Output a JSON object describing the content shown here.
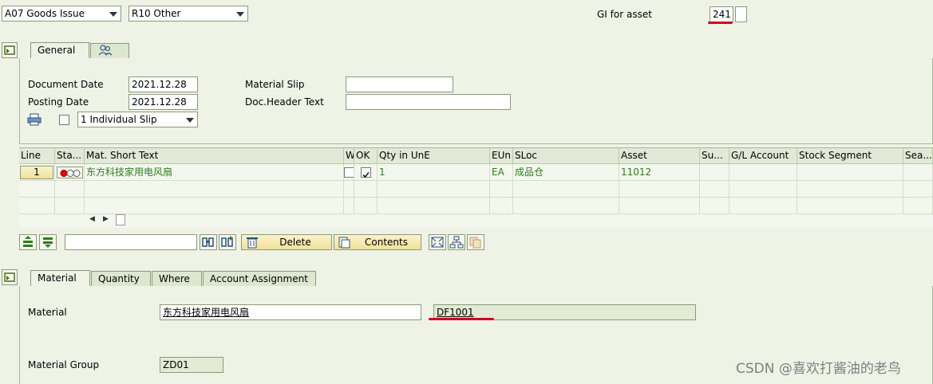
{
  "header": {
    "movement_type": "A07 Goods Issue",
    "reference": "R10 Other",
    "gi_for_asset_label": "GI for asset",
    "gi_for_asset_value": "241"
  },
  "header_tabs": [
    {
      "label": "General",
      "active": true
    },
    {
      "label": "",
      "icon": "persons-icon",
      "active": false
    }
  ],
  "general": {
    "document_date_label": "Document Date",
    "document_date": "2021.12.28",
    "posting_date_label": "Posting Date",
    "posting_date": "2021.12.28",
    "material_slip_label": "Material Slip",
    "material_slip": "",
    "doc_header_text_label": "Doc.Header Text",
    "doc_header_text": "",
    "slip_option": "1 Individual Slip"
  },
  "grid": {
    "columns": [
      "Line",
      "Sta...",
      "Mat. Short Text",
      "W",
      "OK",
      "Qty in UnE",
      "EUn",
      "SLoc",
      "Asset",
      "Su...",
      "G/L Account",
      "Stock Segment",
      "Sea..."
    ],
    "rows": [
      {
        "line": "1",
        "mat_short_text": "东方科技家用电风扇",
        "qty": "1",
        "eun": "EA",
        "sloc": "成品仓",
        "asset": "11012"
      }
    ]
  },
  "toolbar": {
    "delete_label": "Delete",
    "contents_label": "Contents"
  },
  "item_tabs": [
    {
      "label": "Material",
      "active": true
    },
    {
      "label": "Quantity",
      "active": false
    },
    {
      "label": "Where",
      "active": false
    },
    {
      "label": "Account Assignment",
      "active": false
    }
  ],
  "item": {
    "material_label": "Material",
    "material_text": "东方科技家用电风扇",
    "material_number": "DF1001",
    "material_group_label": "Material Group",
    "material_group": "ZD01"
  },
  "watermark": "CSDN @喜欢打酱油的老鸟",
  "colors": {
    "background": "#eef3e6",
    "data_text": "#2e7d1a",
    "annotation": "#d0021b"
  }
}
